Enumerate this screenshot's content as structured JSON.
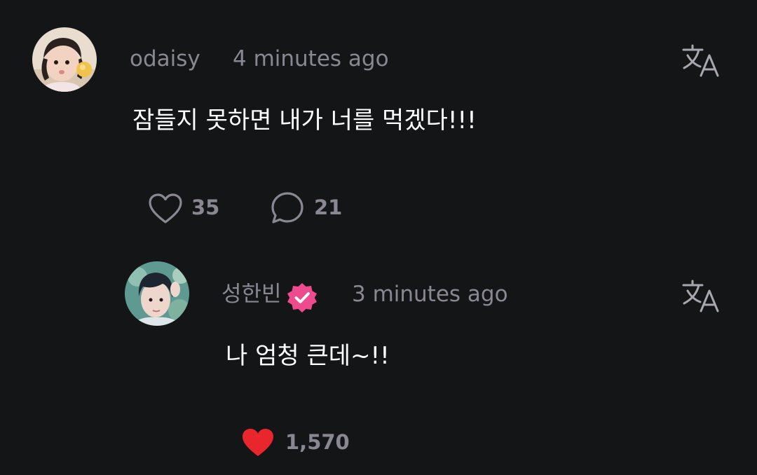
{
  "comments": [
    {
      "username": "odaisy",
      "time": "4 minutes ago",
      "text": "잠들지 못하면 내가 너를 먹겠다!!!",
      "likes": "35",
      "replies": "21",
      "liked": false,
      "verified": false
    },
    {
      "username": "성한빈",
      "time": "3 minutes ago",
      "text": "나 엄청 큰데~!!",
      "likes": "1,570",
      "liked": true,
      "verified": true
    }
  ],
  "colors": {
    "background": "#141517",
    "meta_text": "#8a8793",
    "body_text": "#ffffff",
    "like_active": "#e8262b",
    "verified_badge": "#ee4b8e"
  },
  "icons": [
    "translate-icon",
    "heart-outline-icon",
    "comment-icon",
    "heart-filled-icon",
    "verified-badge-icon"
  ]
}
